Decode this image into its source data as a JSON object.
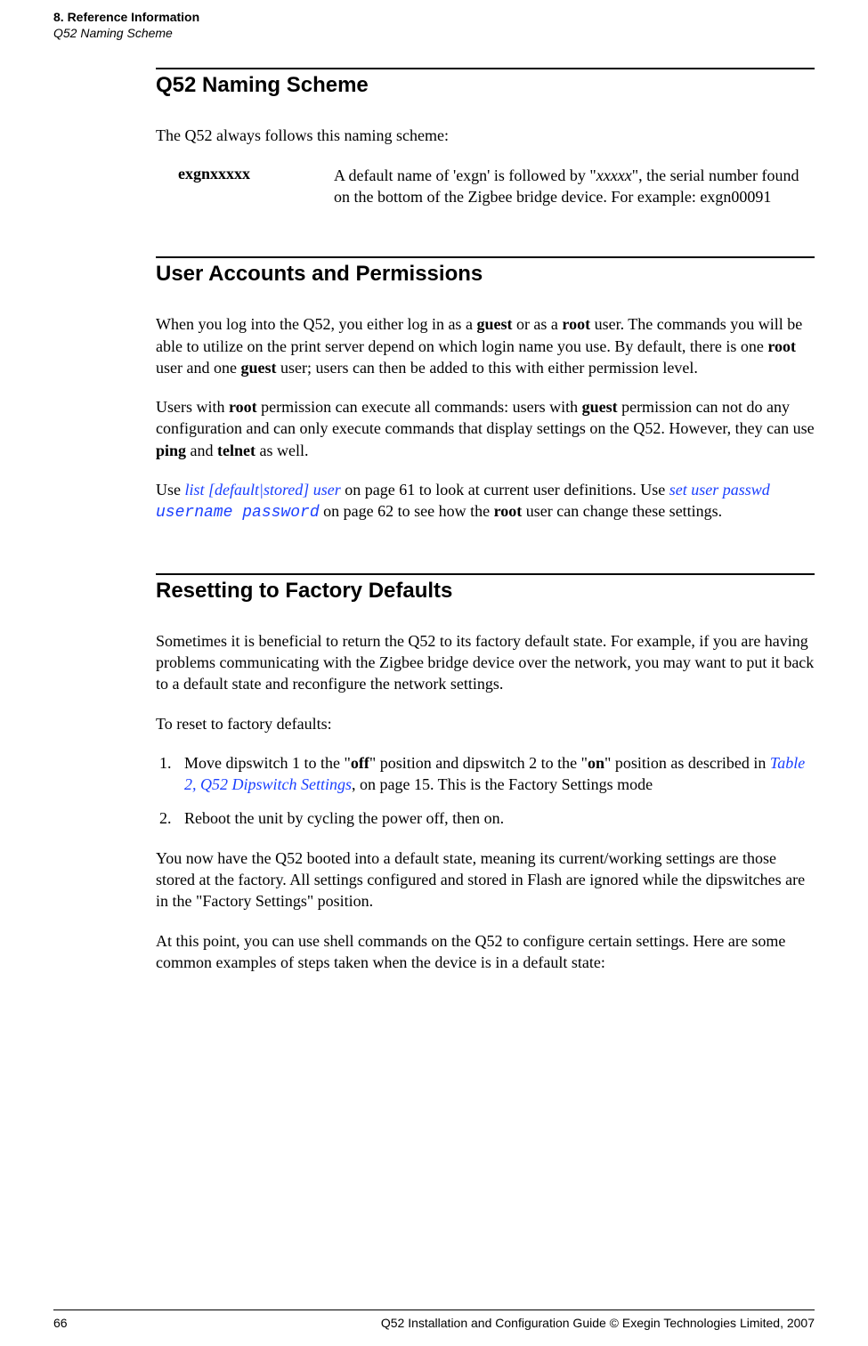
{
  "header": {
    "chapter": "8. Reference Information",
    "section": "Q52 Naming Scheme"
  },
  "sections": [
    {
      "heading": "Q52 Naming Scheme",
      "intro": "The Q52 always follows this naming scheme:",
      "def_term": "exgnxxxxx",
      "def_desc_pre": "A default name of 'exgn' is followed by \"",
      "def_desc_em": "xxxxx",
      "def_desc_post": "\", the serial number found on the bottom of the Zigbee bridge device. For example: exgn00091"
    },
    {
      "heading": "User Accounts and Permissions",
      "p1a": "When you log into the Q52, you either log in as a ",
      "p1_guest": "guest",
      "p1b": " or as a ",
      "p1_root": "root",
      "p1c": " user. The commands you will be able to utilize on the print server depend on which login name you use. By default, there is one ",
      "p1_root2": "root",
      "p1d": " user and one ",
      "p1_guest2": "guest",
      "p1e": " user; users can then be added to this with either permission level.",
      "p2a": "Users with ",
      "p2_root": "root",
      "p2b": " permission can execute all commands: users with ",
      "p2_guest": "guest",
      "p2c": " permission can not do any configuration and can only execute commands that display settings on the Q52. However, they can use ",
      "p2_ping": "ping",
      "p2d": " and ",
      "p2_telnet": "telnet",
      "p2e": " as well.",
      "p3a": "Use ",
      "p3_link1": "list [default|stored] user",
      "p3b": " on page 61 to look at current user definitions. Use ",
      "p3_link2a": "set user passwd ",
      "p3_link2b": "username password",
      "p3c": " on page 62 to see how the ",
      "p3_root": "root",
      "p3d": " user can change these settings."
    },
    {
      "heading": "Resetting to Factory Defaults",
      "p1": "Sometimes it is beneficial to return the Q52 to its factory default state. For example, if you are having problems communicating with the Zigbee bridge device over the network, you may want to put it back to a default state and reconfigure the network settings.",
      "p2": "To reset to factory defaults:",
      "step1a": "Move dipswitch 1 to the \"",
      "step1_off": "off",
      "step1b": "\" position and dipswitch 2 to the \"",
      "step1_on": "on",
      "step1c": "\" position as described in ",
      "step1_link": "Table 2, Q52 Dipswitch Settings",
      "step1d": ", on page 15. This is the Factory Settings mode",
      "step2": "Reboot the unit by cycling the power off, then on.",
      "p3": "You now have the Q52 booted into a default state, meaning its current/working settings are those stored at the factory. All settings configured and stored in Flash are ignored while the dipswitches are in the \"Factory Settings\" position.",
      "p4": "At this point, you can use shell commands on the Q52 to configure certain settings. Here are some common examples of steps taken when the device is in a default state:"
    }
  ],
  "footer": {
    "page": "66",
    "text": "Q52 Installation and Configuration Guide  © Exegin Technologies Limited, 2007"
  }
}
